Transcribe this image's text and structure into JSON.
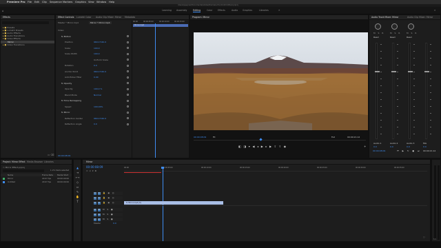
{
  "menubar": {
    "apple": "",
    "app": "Premiere Pro",
    "items": [
      "File",
      "Edit",
      "Clip",
      "Sequence",
      "Markers",
      "Graphics",
      "View",
      "Window",
      "Help"
    ]
  },
  "window_path": "/Users/ajaynair/Documents/Adobe/Premiere Pro/14.0/Untitled.prproj",
  "workspaces": [
    "Learning",
    "Assembly",
    "Editing",
    "Color",
    "Effects",
    "Audio",
    "Graphics",
    "Libraries"
  ],
  "workspace_active": "Editing",
  "effects": {
    "tab": "Effects",
    "search": "",
    "folders": [
      "Presets",
      "Lumetri Presets",
      "Audio Effects",
      "Audio Transitions",
      "Video Effects",
      "Mirror",
      "Video Transitions"
    ]
  },
  "effect_controls": {
    "tabs": [
      "Effect Controls",
      "Lumetri Color",
      "Audio Clip Mixer: Mirror",
      "Metadata"
    ],
    "source": "Master * Mirror.mp4",
    "clip": "Mirror * Mirror.mp4",
    "timecodes": [
      "00:00",
      "00:00:05:00",
      "00:00:10:00",
      "00:00:15:00"
    ],
    "clip_bar": "Mirror.mp4",
    "rows": [
      {
        "label": "Video",
        "indent": 0,
        "value": ""
      },
      {
        "label": "fx Motion",
        "indent": 1,
        "value": ""
      },
      {
        "label": "Position",
        "indent": 2,
        "value": "960.0   540.0"
      },
      {
        "label": "Scale",
        "indent": 2,
        "value": "100.0"
      },
      {
        "label": "Scale Width",
        "indent": 2,
        "value": "100.0"
      },
      {
        "label": "",
        "indent": 2,
        "value": "Uniform Scale"
      },
      {
        "label": "Rotation",
        "indent": 2,
        "value": "0.0"
      },
      {
        "label": "Anchor Point",
        "indent": 2,
        "value": "960.0   540.0"
      },
      {
        "label": "Anti-flicker Filter",
        "indent": 2,
        "value": "0.00"
      },
      {
        "label": "fx Opacity",
        "indent": 1,
        "value": ""
      },
      {
        "label": "Opacity",
        "indent": 2,
        "value": "100.0 %"
      },
      {
        "label": "Blend Mode",
        "indent": 2,
        "value": "Normal"
      },
      {
        "label": "fx Time Remapping",
        "indent": 1,
        "value": ""
      },
      {
        "label": "Speed",
        "indent": 2,
        "value": "100.00%"
      },
      {
        "label": "fx Mirror",
        "indent": 1,
        "value": ""
      },
      {
        "label": "Reflection Center",
        "indent": 2,
        "value": "960.0   540.0"
      },
      {
        "label": "Reflection Angle",
        "indent": 2,
        "value": "0.0"
      }
    ],
    "timecode_bottom": "00:00:08:09"
  },
  "program": {
    "tab": "Program: Mirror",
    "timecode": "00:00:08:09",
    "fit": "Fit",
    "quality": "Full",
    "duration": "00:00:21:12"
  },
  "mixer": {
    "tabs": [
      "Audio Track Mixer: Mirror",
      "Audio Clip Mixer: Mirror"
    ],
    "channels": [
      "A1",
      "A2",
      "A3"
    ],
    "labels": [
      "Audio 1",
      "Audio 2",
      "Audio 3",
      "Mix"
    ],
    "mode": "Read",
    "db": "0.0",
    "timecode": "00:00:08:09",
    "end": "00:00:21:12"
  },
  "project": {
    "tabs": [
      "Project: Mirror Effect",
      "Media Browser",
      "Libraries"
    ],
    "file": "Mirror Effect.prproj",
    "count": "1 of 2 items selected",
    "headers": [
      "Name",
      "Frame Rate",
      "Media Start"
    ],
    "items": [
      {
        "name": "Mirror",
        "fps": "29.97 fps",
        "start": "00:00:00:00"
      },
      {
        "name": "Untitled",
        "fps": "29.97 fps",
        "start": "00:00:00:00"
      }
    ]
  },
  "timeline": {
    "tab": "Mirror",
    "timecode": "00:00:08:09",
    "ruler": [
      "00:00",
      "00:00:05:00",
      "00:00:10:00",
      "00:00:15:00",
      "00:00:20:00",
      "00:00:25:00",
      "00:00:30:00",
      "00:00:35:00"
    ],
    "tracks_v": [
      "V3",
      "V2",
      "V1"
    ],
    "tracks_a": [
      "A1",
      "A2",
      "A3"
    ],
    "master": "Master",
    "master_val": "0.0",
    "clip": "fx  Mirror.mp4 [V]"
  },
  "colors": {
    "accent": "#3f8ef5",
    "clip": "#a9bee6",
    "track_on": "#3a6ea5"
  }
}
